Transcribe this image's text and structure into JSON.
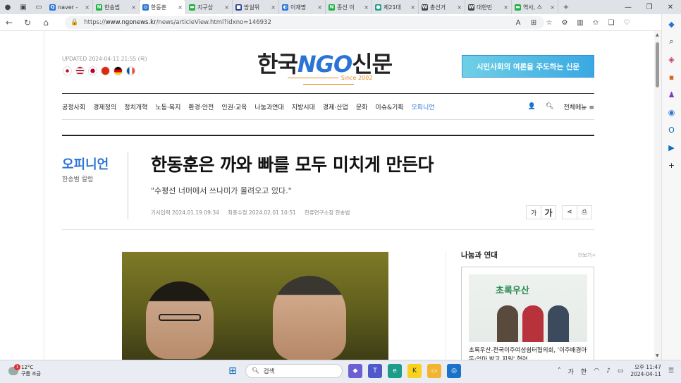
{
  "browser": {
    "tabs": [
      {
        "label": "naver -",
        "fav_color": "#2a74d6",
        "fav": "Q"
      },
      {
        "label": "한송범",
        "fav_color": "#1fb141",
        "fav": "N"
      },
      {
        "label": "한동훈",
        "fav_color": "#2a74d6",
        "fav": "◎",
        "active": true
      },
      {
        "label": "지구상",
        "fav_color": "#1fb141",
        "fav": "▬"
      },
      {
        "label": "방실위",
        "fav_color": "#2c3e8f",
        "fav": "■"
      },
      {
        "label": "이재명",
        "fav_color": "#2a74d6",
        "fav": "◐"
      },
      {
        "label": "종선 이",
        "fav_color": "#1fb141",
        "fav": "N"
      },
      {
        "label": "제21대",
        "fav_color": "#1ea08c",
        "fav": "●"
      },
      {
        "label": "총선거",
        "fav_color": "#444444",
        "fav": "W"
      },
      {
        "label": "대한민",
        "fav_color": "#444444",
        "fav": "W"
      },
      {
        "label": "역사, 스",
        "fav_color": "#1fb141",
        "fav": "▬"
      }
    ],
    "new_tab": "+",
    "url_prefix": "https://",
    "url_host": "www.ngonews.kr",
    "url_path": "/news/articleView.html?idxno=146932"
  },
  "site": {
    "updated": "UPDATED 2024-04-11 21:55 (목)",
    "logo_a": "한국",
    "logo_b": "NGO",
    "logo_c": "신문",
    "since": "Since 2002",
    "banner": "시민사회의 여론을 주도하는 신문",
    "menu": [
      "공정사회",
      "경제정의",
      "정치개혁",
      "노동·복지",
      "환경·안전",
      "인권·교육",
      "나눔과연대",
      "지방시대",
      "경제·산업",
      "문화",
      "이슈&기획",
      "오피니언"
    ],
    "menu_active": "오피니언",
    "all_menu": "전체메뉴 ≡",
    "flags": [
      {
        "name": "korea-flag",
        "color": "#ffffff"
      },
      {
        "name": "usa-flag",
        "color": "#3b5ba5"
      },
      {
        "name": "japan-flag",
        "color": "#ffffff"
      },
      {
        "name": "china-flag",
        "color": "#de2910"
      },
      {
        "name": "germany-flag",
        "color": "#222222"
      },
      {
        "name": "france-flag",
        "color": "#0055a4"
      }
    ]
  },
  "article": {
    "section": "오피니언",
    "column": "한송범 칼럼",
    "headline": "한동훈은 까와 빠를 모두 미치게 만든다",
    "subhead": "\"수평선 너머에서 쓰나미가 몰려오고 있다.\"",
    "meta": [
      "기사입력 2024.01.19 09:34",
      "최종수정 2024.02.01 10:51",
      "한류연구소장 한송범"
    ],
    "font_small": "가",
    "font_large": "가"
  },
  "sidebar": {
    "title": "나눔과 연대",
    "more": "더보기+",
    "card_brand": "초록우산",
    "card_text": "초록우산-전국이주여성쉼터협의회, '이주배경아동·엄마 밝고 지원' 협력"
  },
  "taskbar": {
    "temp": "12°C",
    "weather": "구름 조금",
    "search_placeholder": "검색",
    "ime": "가",
    "ime2": "한",
    "time": "오후 11:47",
    "date": "2024-04-11",
    "badge": "1"
  }
}
